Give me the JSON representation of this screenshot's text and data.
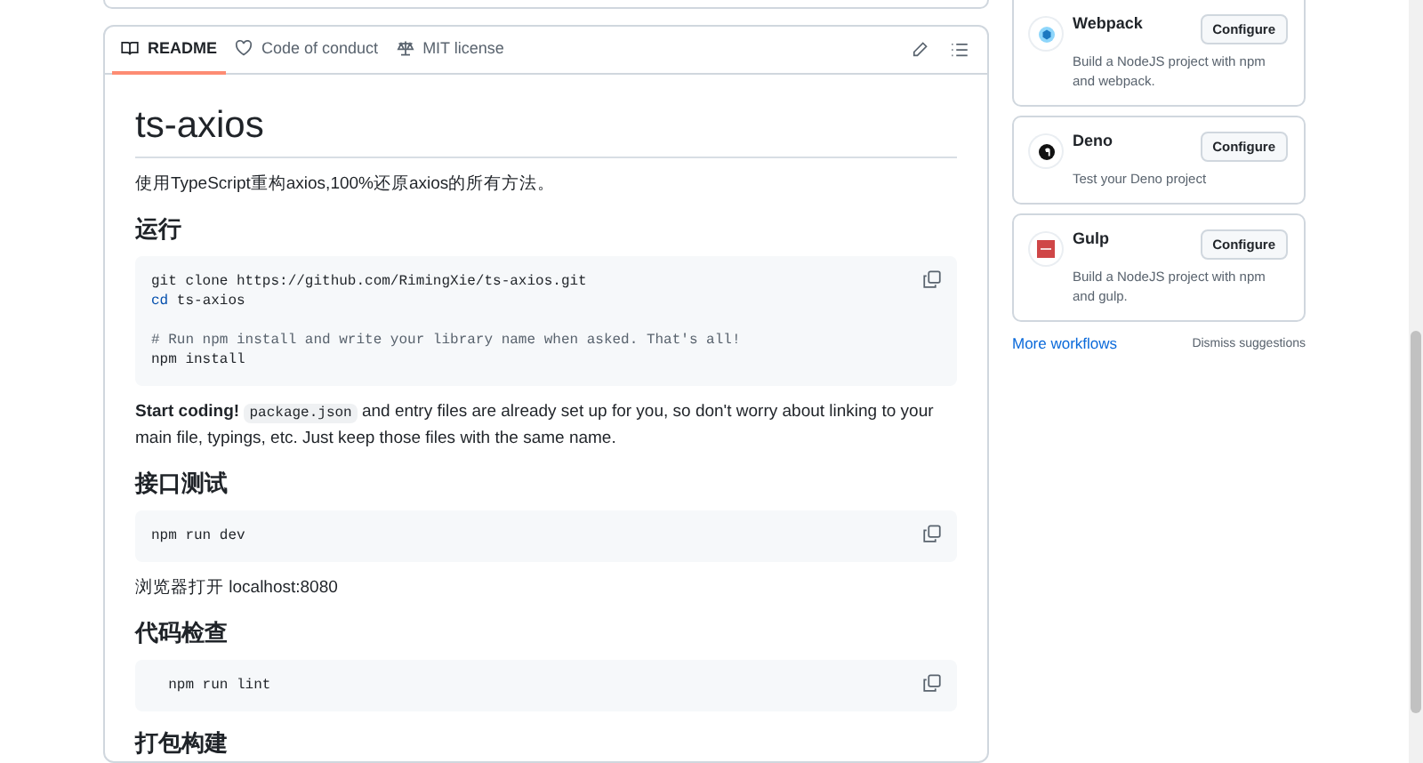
{
  "readme": {
    "tabs": [
      {
        "label": "README",
        "selected": true
      },
      {
        "label": "Code of conduct",
        "selected": false
      },
      {
        "label": "MIT license",
        "selected": false
      }
    ],
    "title": "ts-axios",
    "blocks": [
      {
        "kind": "paragraph",
        "parts": [
          {
            "kind": "text",
            "text": "使用TypeScript重构axios,100%还原axios的所有方法。"
          }
        ]
      },
      {
        "kind": "heading",
        "text": "运行"
      },
      {
        "kind": "code",
        "groups": [
          {
            "lines": [
              [
                {
                  "kind": "plain",
                  "text": "git clone https://github.com/RimingXie/ts-axios.git"
                }
              ],
              [
                {
                  "kind": "keyword",
                  "text": "cd"
                },
                {
                  "kind": "plain",
                  "text": " ts-axios"
                }
              ]
            ]
          },
          {
            "lines": [
              [
                {
                  "kind": "comment",
                  "text": "# Run npm install and write your library name when asked. That's all!"
                }
              ],
              [
                {
                  "kind": "plain",
                  "text": "npm install"
                }
              ]
            ]
          }
        ]
      },
      {
        "kind": "paragraph",
        "parts": [
          {
            "kind": "text",
            "text": "**Start coding!** "
          },
          {
            "kind": "code",
            "text": "package.json"
          },
          {
            "kind": "text",
            "text": " and entry files are already set up for you, so don't worry about linking to your main file, typings, etc. Just keep those files with the same name."
          }
        ]
      },
      {
        "kind": "heading",
        "text": "接口测试"
      },
      {
        "kind": "code",
        "groups": [
          {
            "lines": [
              [
                {
                  "kind": "plain",
                  "text": "npm run dev"
                }
              ]
            ]
          }
        ]
      },
      {
        "kind": "paragraph",
        "parts": [
          {
            "kind": "text",
            "text": "浏览器打开 localhost:8080"
          }
        ]
      },
      {
        "kind": "heading",
        "text": "代码检查"
      },
      {
        "kind": "code",
        "groups": [
          {
            "lines": [
              [
                {
                  "kind": "plain",
                  "text": "  npm run lint"
                }
              ]
            ]
          }
        ]
      },
      {
        "kind": "heading",
        "text": "打包构建"
      }
    ]
  },
  "workflows": [
    {
      "name": "Webpack",
      "description": "Build a NodeJS project with npm and webpack.",
      "button": "Configure"
    },
    {
      "name": "Deno",
      "description": "Test your Deno project",
      "button": "Configure"
    },
    {
      "name": "Gulp",
      "description": "Build a NodeJS project with npm and gulp.",
      "button": "Configure"
    }
  ],
  "more_link": "More workflows",
  "dismiss": "Dismiss suggestions"
}
